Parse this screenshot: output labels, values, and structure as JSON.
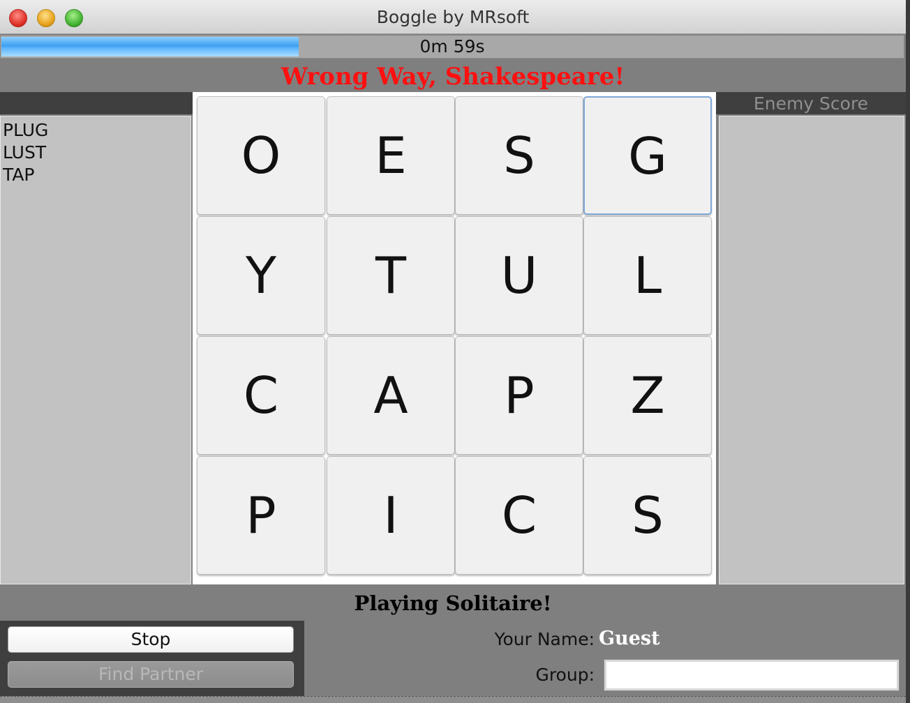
{
  "window": {
    "title": "Boggle by MRsoft"
  },
  "timer": {
    "text": "0m 59s",
    "progress": 0.33
  },
  "banner": {
    "text": "Wrong Way, Shakespeare!"
  },
  "found_words": [
    "PLUG",
    "LUST",
    "TAP"
  ],
  "board": {
    "rows": [
      [
        "O",
        "E",
        "S",
        "G"
      ],
      [
        "Y",
        "T",
        "U",
        "L"
      ],
      [
        "C",
        "A",
        "P",
        "Z"
      ],
      [
        "P",
        "I",
        "C",
        "S"
      ]
    ],
    "focused": "row-1-col-4"
  },
  "enemy": {
    "header": "Enemy Score"
  },
  "status": {
    "text": "Playing Solitaire!"
  },
  "controls": {
    "stop_label": "Stop",
    "find_partner_label": "Find Partner"
  },
  "user": {
    "name_label": "Your Name:",
    "name_value": "Guest",
    "group_label": "Group:",
    "group_value": ""
  },
  "colors": {
    "banner": "#ff1010",
    "progress": "#3d9ff0",
    "background": "#7f7f7f"
  }
}
